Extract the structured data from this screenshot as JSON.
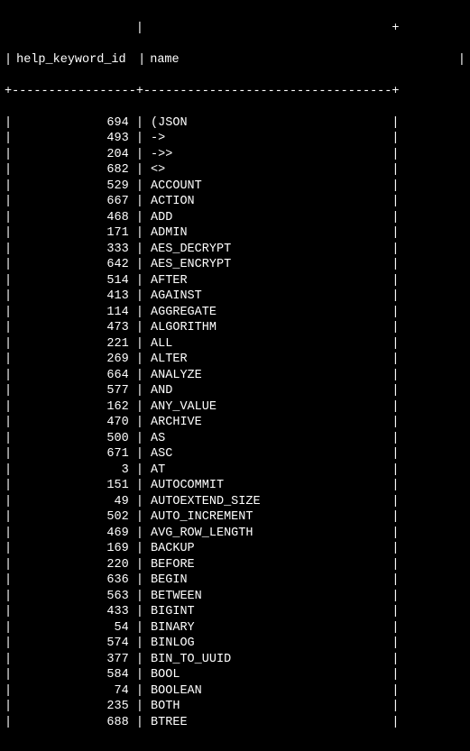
{
  "header": {
    "col1": "help_keyword_id",
    "col2": "name"
  },
  "rows": [
    {
      "id": "694",
      "name": "(JSON"
    },
    {
      "id": "493",
      "name": "->"
    },
    {
      "id": "204",
      "name": "->>"
    },
    {
      "id": "682",
      "name": "<>"
    },
    {
      "id": "529",
      "name": "ACCOUNT"
    },
    {
      "id": "667",
      "name": "ACTION"
    },
    {
      "id": "468",
      "name": "ADD"
    },
    {
      "id": "171",
      "name": "ADMIN"
    },
    {
      "id": "333",
      "name": "AES_DECRYPT"
    },
    {
      "id": "642",
      "name": "AES_ENCRYPT"
    },
    {
      "id": "514",
      "name": "AFTER"
    },
    {
      "id": "413",
      "name": "AGAINST"
    },
    {
      "id": "114",
      "name": "AGGREGATE"
    },
    {
      "id": "473",
      "name": "ALGORITHM"
    },
    {
      "id": "221",
      "name": "ALL"
    },
    {
      "id": "269",
      "name": "ALTER"
    },
    {
      "id": "664",
      "name": "ANALYZE"
    },
    {
      "id": "577",
      "name": "AND"
    },
    {
      "id": "162",
      "name": "ANY_VALUE"
    },
    {
      "id": "470",
      "name": "ARCHIVE"
    },
    {
      "id": "500",
      "name": "AS"
    },
    {
      "id": "671",
      "name": "ASC"
    },
    {
      "id": "3",
      "name": "AT"
    },
    {
      "id": "151",
      "name": "AUTOCOMMIT"
    },
    {
      "id": "49",
      "name": "AUTOEXTEND_SIZE"
    },
    {
      "id": "502",
      "name": "AUTO_INCREMENT"
    },
    {
      "id": "469",
      "name": "AVG_ROW_LENGTH"
    },
    {
      "id": "169",
      "name": "BACKUP"
    },
    {
      "id": "220",
      "name": "BEFORE"
    },
    {
      "id": "636",
      "name": "BEGIN"
    },
    {
      "id": "563",
      "name": "BETWEEN"
    },
    {
      "id": "433",
      "name": "BIGINT"
    },
    {
      "id": "54",
      "name": "BINARY"
    },
    {
      "id": "574",
      "name": "BINLOG"
    },
    {
      "id": "377",
      "name": "BIN_TO_UUID"
    },
    {
      "id": "584",
      "name": "BOOL"
    },
    {
      "id": "74",
      "name": "BOOLEAN"
    },
    {
      "id": "235",
      "name": "BOTH"
    },
    {
      "id": "688",
      "name": "BTREE"
    }
  ]
}
